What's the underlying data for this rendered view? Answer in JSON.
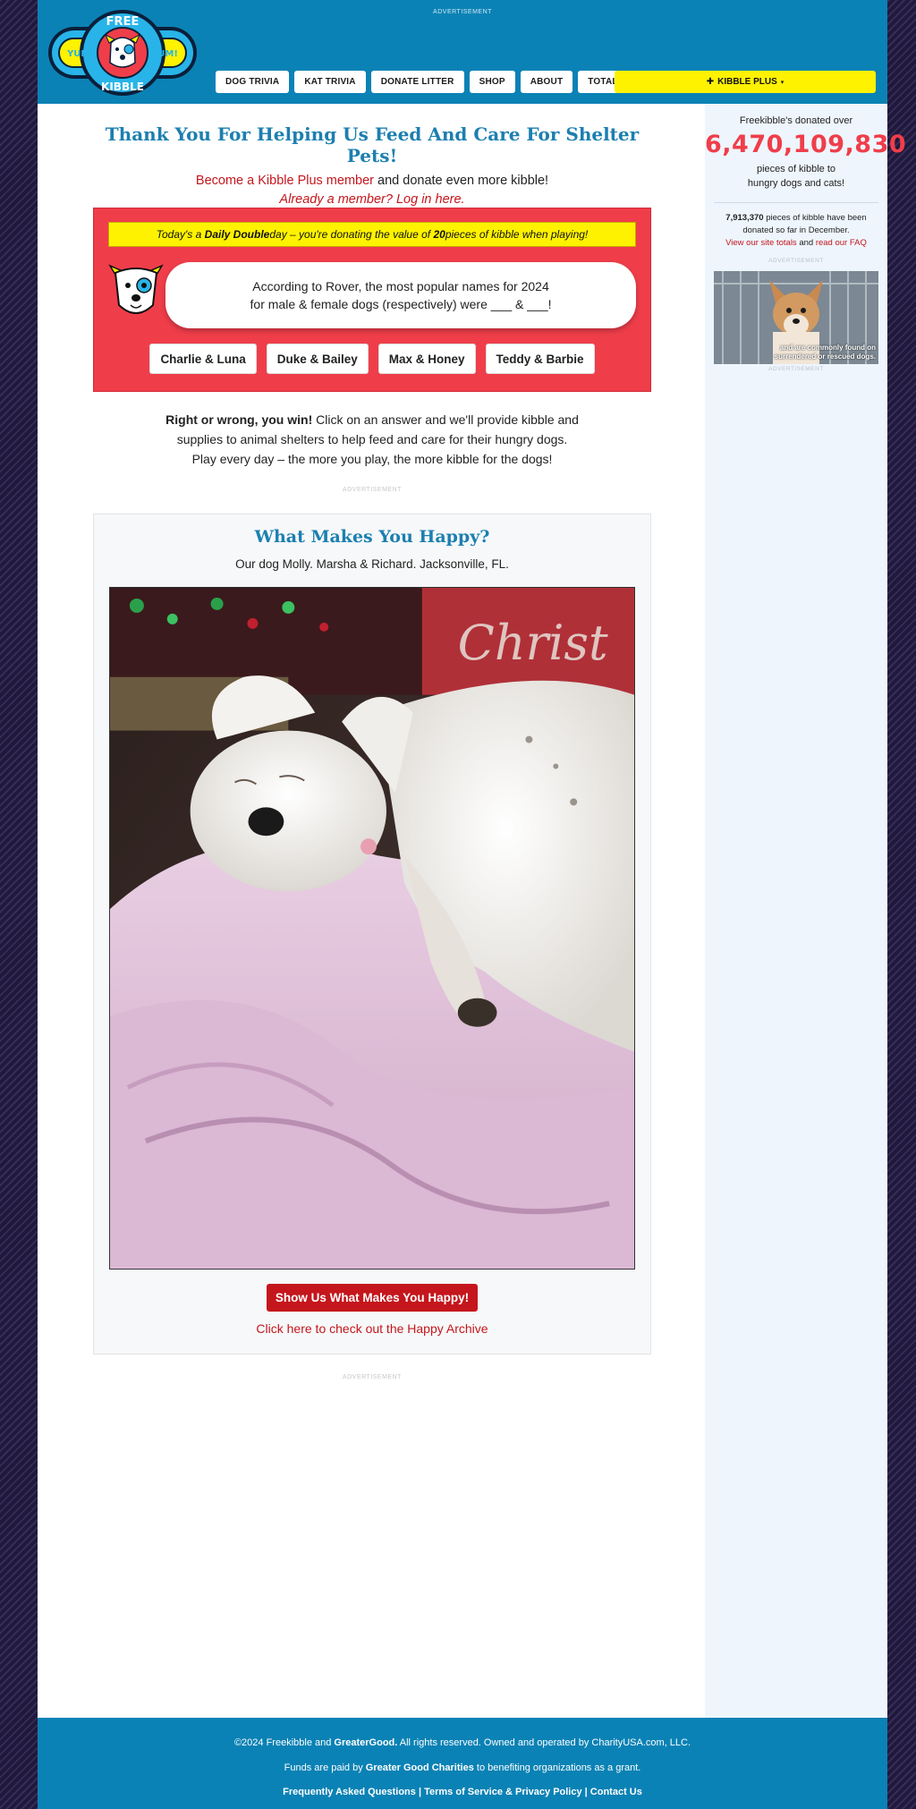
{
  "header": {
    "ad_label": "ADVERTISEMENT",
    "logo_top": "FREE",
    "logo_bottom": "KIBBLE",
    "logo_left_badge": "YUM!",
    "logo_right_badge": "YUM!",
    "nav": [
      "DOG TRIVIA",
      "KAT TRIVIA",
      "DONATE LITTER",
      "SHOP",
      "ABOUT",
      "TOTALS"
    ],
    "kibble_plus": "KIBBLE PLUS"
  },
  "main": {
    "headline": "Thank You For Helping Us Feed And Care For Shelter Pets!",
    "become_link": "Become a Kibble Plus member",
    "become_rest": " and donate even more kibble!",
    "login_link": "Already a member? Log in here.",
    "trivia": {
      "banner_pre": "Today's a ",
      "banner_bold1": "Daily Double",
      "banner_mid": " day – you're donating the value of ",
      "banner_bold2": "20",
      "banner_post": " pieces of kibble when playing!",
      "question_line1": "According to Rover, the most popular names for 2024",
      "question_line2": "for male & female dogs (respectively) were ___ & ___!",
      "answers": [
        "Charlie & Luna",
        "Duke & Bailey",
        "Max & Honey",
        "Teddy & Barbie"
      ]
    },
    "rw_bold": "Right or wrong, you win!",
    "rw_rest": " Click on an answer and we'll provide kibble and supplies to animal shelters to help feed and care for their hungry dogs. Play every day – the more you play, the more kibble for the dogs!",
    "ad_label": "ADVERTISEMENT",
    "happy": {
      "title": "What Makes You Happy?",
      "caption": "Our dog Molly. Marsha & Richard. Jacksonville, FL.",
      "photo_text": "Christ",
      "button": "Show Us What Makes You Happy!",
      "archive_link": "Click here to check out the Happy Archive"
    },
    "ad_label_low": "ADVERTISEMENT"
  },
  "sidebar": {
    "line1": "Freekibble's donated over",
    "total": "6,470,109,830",
    "line2a": "pieces of kibble to",
    "line2b": "hungry dogs and cats!",
    "month_count": "7,913,370",
    "month_text": " pieces of kibble have been donated so far in December.",
    "totals_link": "View our site totals",
    "and": " and ",
    "faq_link": "read our FAQ",
    "ad_label": "ADVERTISEMENT",
    "ad_caption1": "and are commonly found on",
    "ad_caption2": "surrendered or rescued dogs.",
    "ad_label_bottom": "ADVERTISEMENT"
  },
  "footer": {
    "copyright_pre": "©2024 Freekibble and ",
    "copyright_bold": "GreaterGood.",
    "copyright_post": " All rights reserved. Owned and operated by CharityUSA.com, LLC.",
    "funds_pre": "Funds are paid by ",
    "funds_bold": "Greater Good Charities",
    "funds_post": " to benefiting organizations as a grant.",
    "links": [
      "Frequently Asked Questions",
      "Terms of Service & Privacy Policy",
      "Contact Us"
    ],
    "separator": " | "
  },
  "colors": {
    "brand_blue": "#0b82b5",
    "heading_blue": "#1c7fb0",
    "accent_red": "#c4161c",
    "trivia_red": "#ef3e4a",
    "yellow": "#fef200",
    "sidebar_bg": "#eef5fd"
  }
}
